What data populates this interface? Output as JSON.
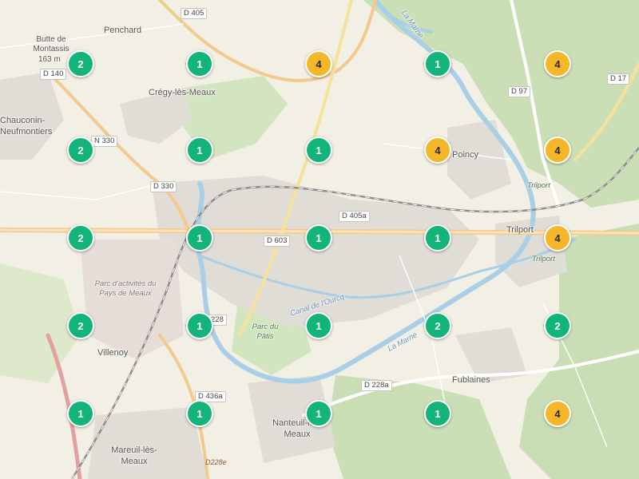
{
  "colors": {
    "cluster_low": "#12b47a",
    "cluster_high": "#f4b72a",
    "land": "#f2efe4",
    "water": "#a9cfe6",
    "forest": "#c6ddb1",
    "urban": "#e0dcd6"
  },
  "places": {
    "penchard": "Penchard",
    "butte_name": "Butte de Montassis",
    "butte_elevation": "163 m",
    "cregy": "Crégy-lès-Meaux",
    "chauconin": "Chauconin-Neufmontiers",
    "poincy": "Poincy",
    "trilport": "Trilport",
    "trilport_italic": "Trilport",
    "trilport_italic_2": "Trilport",
    "parc_activites": "Parc d'activités du Pays de Meaux",
    "parc_patis": "Parc du Pâtis",
    "villenoy": "Villenoy",
    "fublaines": "Fublaines",
    "nanteuil": "Nanteuil-lès-Meaux",
    "mareuil": "Mareuil-lès-Meaux",
    "la_marne_1": "La Marne",
    "la_marne_2": "La Marne",
    "canal": "Canal de l'Ourcq"
  },
  "roads": {
    "d405": "D 405",
    "d140": "D 140",
    "n330": "N 330",
    "d330": "D 330",
    "d97": "D 97",
    "d17": "D 17",
    "d405a": "D 405a",
    "d603": "D 603",
    "d228": "228",
    "d436a": "D 436a",
    "d228a": "D 228a",
    "d228e": "D228e"
  },
  "clusters": [
    {
      "count": "2",
      "level": "low"
    },
    {
      "count": "1",
      "level": "low"
    },
    {
      "count": "4",
      "level": "high"
    },
    {
      "count": "1",
      "level": "low"
    },
    {
      "count": "4",
      "level": "high"
    },
    {
      "count": "2",
      "level": "low"
    },
    {
      "count": "1",
      "level": "low"
    },
    {
      "count": "1",
      "level": "low"
    },
    {
      "count": "4",
      "level": "high"
    },
    {
      "count": "4",
      "level": "high"
    },
    {
      "count": "2",
      "level": "low"
    },
    {
      "count": "1",
      "level": "low"
    },
    {
      "count": "1",
      "level": "low"
    },
    {
      "count": "1",
      "level": "low"
    },
    {
      "count": "4",
      "level": "high"
    },
    {
      "count": "2",
      "level": "low"
    },
    {
      "count": "1",
      "level": "low"
    },
    {
      "count": "1",
      "level": "low"
    },
    {
      "count": "2",
      "level": "low"
    },
    {
      "count": "2",
      "level": "low"
    },
    {
      "count": "1",
      "level": "low"
    },
    {
      "count": "1",
      "level": "low"
    },
    {
      "count": "1",
      "level": "low"
    },
    {
      "count": "1",
      "level": "low"
    },
    {
      "count": "4",
      "level": "high"
    }
  ]
}
